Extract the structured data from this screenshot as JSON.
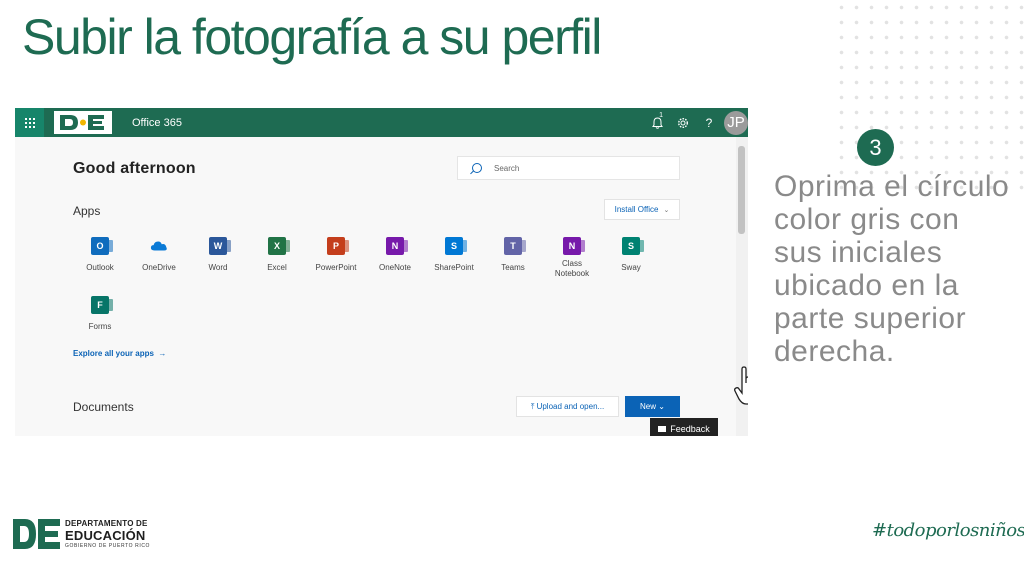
{
  "slide": {
    "title": "Subir la fotografía a su perfil",
    "step_number": "3",
    "instruction": "Oprima el círculo color gris con sus iniciales ubicado en la parte superior derecha.",
    "hashtag": "#todoporlosniños",
    "footer": {
      "line1": "DEPARTAMENTO DE",
      "line2": "EDUCACIÓN",
      "line3": "GOBIERNO DE PUERTO RICO"
    }
  },
  "office": {
    "app_name": "Office 365",
    "notification_count": "1",
    "avatar_initials": "JP",
    "greeting": "Good afternoon",
    "search_placeholder": "Search",
    "apps_heading": "Apps",
    "install_label": "Install Office",
    "apps": [
      {
        "label": "Outlook",
        "icon": "outlook-icon",
        "color": "#0f6cbd",
        "letter": "O"
      },
      {
        "label": "OneDrive",
        "icon": "onedrive-icon",
        "color": "#0a7ad6",
        "letter": ""
      },
      {
        "label": "Word",
        "icon": "word-icon",
        "color": "#2b579a",
        "letter": "W"
      },
      {
        "label": "Excel",
        "icon": "excel-icon",
        "color": "#217346",
        "letter": "X"
      },
      {
        "label": "PowerPoint",
        "icon": "powerpoint-icon",
        "color": "#c43e1c",
        "letter": "P"
      },
      {
        "label": "OneNote",
        "icon": "onenote-icon",
        "color": "#7719aa",
        "letter": "N"
      },
      {
        "label": "SharePoint",
        "icon": "sharepoint-icon",
        "color": "#0078d4",
        "letter": "S"
      },
      {
        "label": "Teams",
        "icon": "teams-icon",
        "color": "#6264a7",
        "letter": "T"
      },
      {
        "label": "Class Notebook",
        "icon": "class-notebook-icon",
        "color": "#7719aa",
        "letter": "N"
      },
      {
        "label": "Sway",
        "icon": "sway-icon",
        "color": "#008272",
        "letter": "S"
      },
      {
        "label": "Forms",
        "icon": "forms-icon",
        "color": "#077568",
        "letter": "F"
      }
    ],
    "explore_label": "Explore all your apps",
    "documents_heading": "Documents",
    "upload_label": "Upload and open...",
    "new_label": "New",
    "feedback_label": "Feedback"
  }
}
